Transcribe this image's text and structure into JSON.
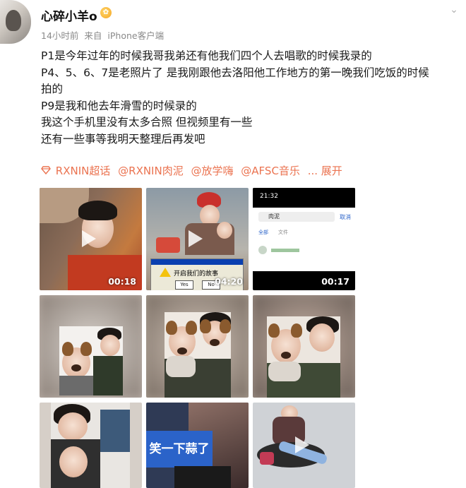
{
  "post": {
    "username": "心碎小羊o",
    "time": "14小时前",
    "source_prefix": "来自",
    "source": "iPhone客户端",
    "lines": [
      "P1是今年过年的时候我哥我弟还有他我们四个人去唱歌的时候我录的",
      "P4、5、6、7是老照片了 是我刚跟他去洛阳他工作地方的第一晚我们吃饭的时候",
      "拍的",
      "P9是我和他去年滑雪的时候录的",
      "我这个手机里没有太多合照 但视频里有一些",
      "还有一些事等我明天整理后再发吧"
    ],
    "topics": [
      "RXNIN超话",
      "@RXNIN肉泥",
      "@放学嗨",
      "@AFSC音乐",
      "... 展开"
    ],
    "expand_label": "展开"
  },
  "media": [
    {
      "type": "video",
      "duration": "00:18"
    },
    {
      "type": "video",
      "duration": "04:20",
      "popup_text": "开启我们的故事",
      "popup_yes": "Yes",
      "popup_no": "No"
    },
    {
      "type": "video",
      "duration": "00:17",
      "status_time": "21:32",
      "search_text": "肉泥",
      "cancel": "取消",
      "tab1": "全部",
      "tab2": "文件"
    },
    {
      "type": "image"
    },
    {
      "type": "image"
    },
    {
      "type": "image"
    },
    {
      "type": "image"
    },
    {
      "type": "image",
      "caption": "笑一下蒜了"
    },
    {
      "type": "image"
    }
  ],
  "colors": {
    "accent": "#eb7350",
    "meta": "#8a8a8a"
  },
  "icons": {
    "vip": "crown-badge-icon",
    "more": "chevron-down-icon",
    "play": "play-icon",
    "topic": "diamond-icon"
  }
}
